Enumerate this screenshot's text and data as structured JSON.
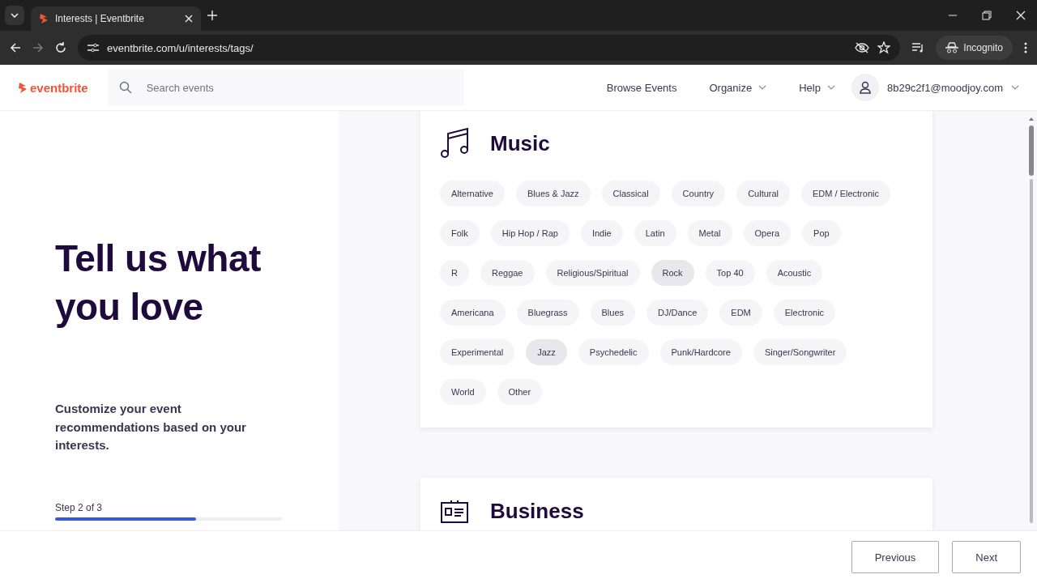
{
  "browser": {
    "tab_title": "Interests | Eventbrite",
    "url": "eventbrite.com/u/interests/tags/",
    "profile": "Incognito"
  },
  "header": {
    "logo": "eventbrite",
    "search": {
      "placeholder": "Search events"
    },
    "nav": [
      {
        "label": "Browse Events",
        "dropdown": false
      },
      {
        "label": "Organize",
        "dropdown": true
      },
      {
        "label": "Help",
        "dropdown": true
      }
    ],
    "account": "8b29c2f1@moodjoy.com"
  },
  "intro": {
    "title": "Tell us what you love",
    "description": "Customize your event recommendations based on your interests.",
    "step": "Step 2 of 3",
    "level": 0.62
  },
  "categories": [
    {
      "title": "Music",
      "kind": "music",
      "tags": [
        {
          "label": "Alternative",
          "selected": false
        },
        {
          "label": "Blues & Jazz",
          "selected": false
        },
        {
          "label": "Classical",
          "selected": false
        },
        {
          "label": "Country",
          "selected": false
        },
        {
          "label": "Cultural",
          "selected": false
        },
        {
          "label": "EDM / Electronic",
          "selected": false
        },
        {
          "label": "Folk",
          "selected": false
        },
        {
          "label": "Hip Hop / Rap",
          "selected": false
        },
        {
          "label": "Indie",
          "selected": false
        },
        {
          "label": "Latin",
          "selected": false
        },
        {
          "label": "Metal",
          "selected": false
        },
        {
          "label": "Opera",
          "selected": false
        },
        {
          "label": "Pop",
          "selected": false
        },
        {
          "label": "R",
          "selected": false
        },
        {
          "label": "Reggae",
          "selected": false
        },
        {
          "label": "Religious/Spiritual",
          "selected": false
        },
        {
          "label": "Rock",
          "selected": true
        },
        {
          "label": "Top 40",
          "selected": false
        },
        {
          "label": "Acoustic",
          "selected": false
        },
        {
          "label": "Americana",
          "selected": false
        },
        {
          "label": "Bluegrass",
          "selected": false
        },
        {
          "label": "Blues",
          "selected": false
        },
        {
          "label": "DJ/Dance",
          "selected": false
        },
        {
          "label": "EDM",
          "selected": false
        },
        {
          "label": "Electronic",
          "selected": false
        },
        {
          "label": "Experimental",
          "selected": false
        },
        {
          "label": "Jazz",
          "selected": true
        },
        {
          "label": "Psychedelic",
          "selected": false
        },
        {
          "label": "Punk/Hardcore",
          "selected": false
        },
        {
          "label": "Singer/Songwriter",
          "selected": false
        },
        {
          "label": "World",
          "selected": false
        },
        {
          "label": "Other",
          "selected": false
        }
      ]
    },
    {
      "title": "Business",
      "kind": "business"
    }
  ],
  "footer": {
    "buttons": [
      "Previous",
      "Next"
    ]
  }
}
